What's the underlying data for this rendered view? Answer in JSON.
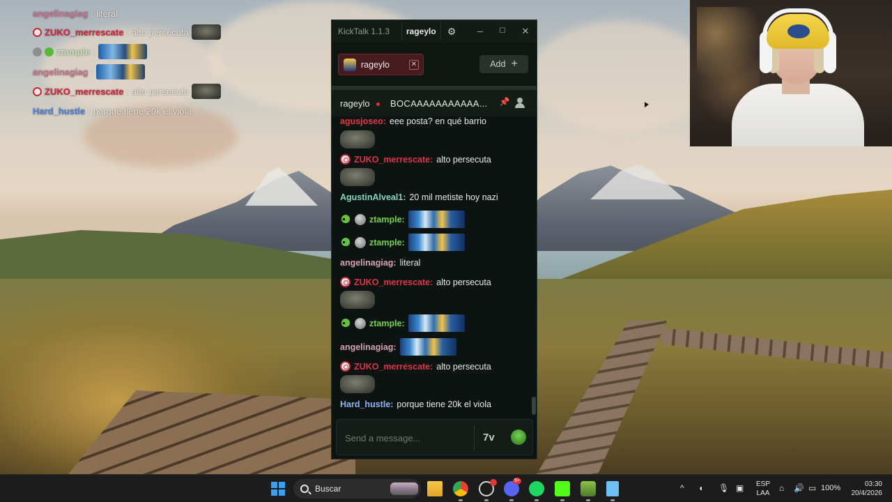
{
  "overlay": {
    "lines": [
      {
        "user": "angelinagiag",
        "sep": ":",
        "text": "literal",
        "color": "#c4738d"
      },
      {
        "user": "ZUKO_merrescate",
        "sep": ":",
        "text": "alto persecuta",
        "color": "#d2243c"
      },
      {
        "user": "ztample",
        "sep": ":",
        "text": "",
        "color": "#59b83a"
      },
      {
        "user": "angelinagiag",
        "sep": ":",
        "text": "",
        "color": "#c4738d"
      },
      {
        "user": "ZUKO_merrescate",
        "sep": ":",
        "text": "alto persecuta",
        "color": "#d2243c"
      },
      {
        "user": "Hard_hustle",
        "sep": ":",
        "text": "porque tiene 20k el viola",
        "color": "#4f7fd6"
      }
    ]
  },
  "kicktalk": {
    "app_title": "KickTalk 1.1.3",
    "current_user": "rageylo",
    "tab": {
      "label": "rageylo"
    },
    "add_label": "Add",
    "header": {
      "channel": "rageylo",
      "stream_title": "BOCAAAAAAAAAAA..."
    },
    "messages": [
      {
        "user": "agusjoseo",
        "sep": ":",
        "text": "eee posta? en qué barrio",
        "color": "#e03a48"
      },
      {
        "user": "ZUKO_merrescate",
        "sep": ":",
        "text": "alto persecuta",
        "color": "#e0334a"
      },
      {
        "user": "AgustinAlveal1",
        "sep": ":",
        "text": "20 mil metiste hoy nazi",
        "color": "#7fd6c1"
      },
      {
        "user": "ztample",
        "sep": ":",
        "text": "",
        "color": "#73d24c"
      },
      {
        "user": "ztample",
        "sep": ":",
        "text": "",
        "color": "#73d24c"
      },
      {
        "user": "angelinagiag",
        "sep": ":",
        "text": "literal",
        "color": "#d6a3b5"
      },
      {
        "user": "ZUKO_merrescate",
        "sep": ":",
        "text": "alto persecuta",
        "color": "#e0334a"
      },
      {
        "user": "ztample",
        "sep": ":",
        "text": "",
        "color": "#73d24c"
      },
      {
        "user": "angelinagiag",
        "sep": ":",
        "text": "",
        "color": "#d6a3b5"
      },
      {
        "user": "ZUKO_merrescate",
        "sep": ":",
        "text": "alto persecuta",
        "color": "#e0334a"
      },
      {
        "user": "Hard_hustle",
        "sep": ":",
        "text": "porque tiene 20k el viola",
        "color": "#8fb4f2"
      }
    ],
    "input_placeholder": "Send a message...",
    "seventv_label": "7v"
  },
  "taskbar": {
    "search_label": "Buscar",
    "discord_badge": "9+",
    "lang_top": "ESP",
    "lang_bottom": "LAA",
    "battery": "100%",
    "time": "03:30",
    "date": "20/4/2026"
  }
}
